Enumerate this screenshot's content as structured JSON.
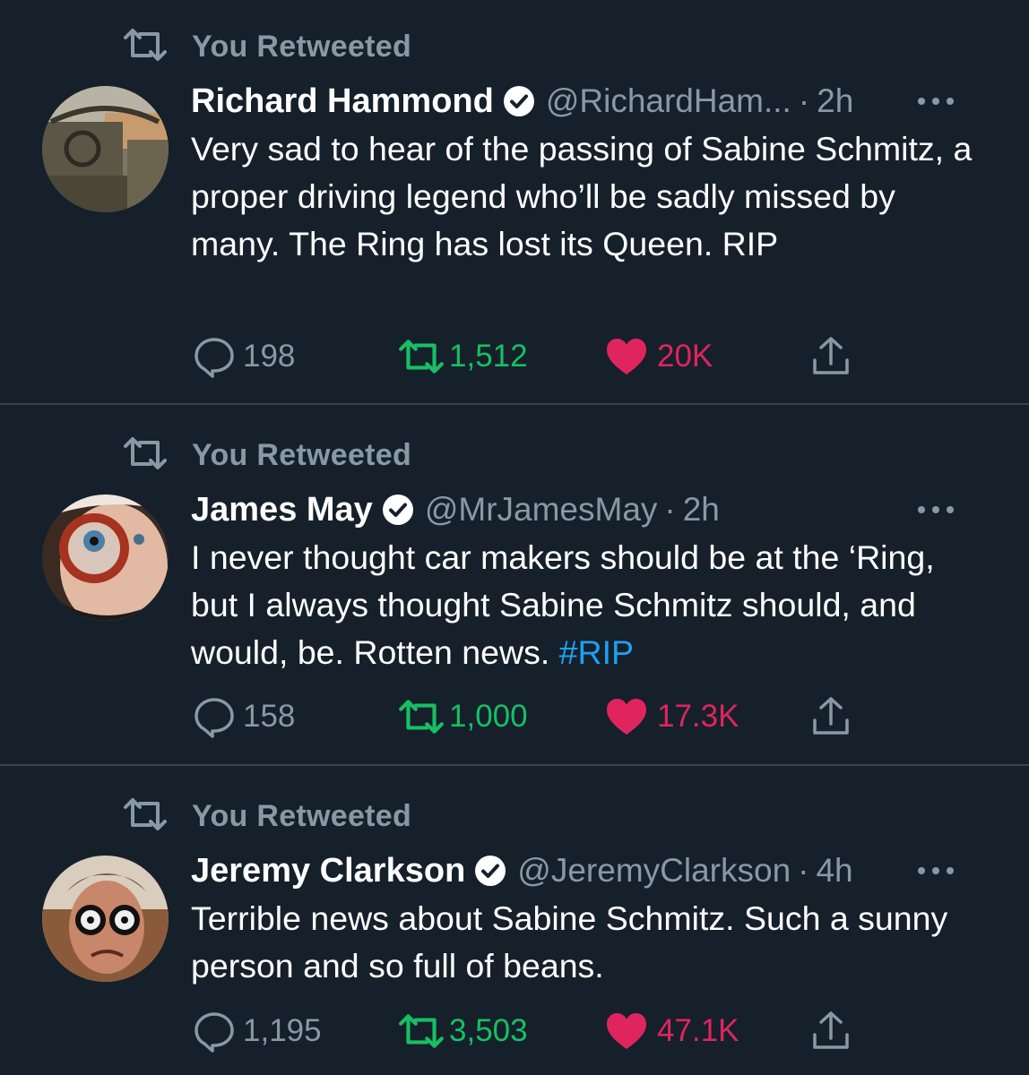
{
  "colors": {
    "background": "#15202b",
    "divider": "#38444d",
    "secondary_text": "#8899a6",
    "retweet_green": "#17bf63",
    "like_red": "#e0245e",
    "hashtag_blue": "#1da1f2",
    "verified_blue": "#1da1f2"
  },
  "tweets": [
    {
      "retweet_label": "You Retweeted",
      "name": "Richard Hammond",
      "handle": "@RichardHam...",
      "separator": "·",
      "time": "2h",
      "text": "Very sad to hear of the passing of Sabine Schmitz, a proper driving legend who’ll be sadly missed by many. The Ring has lost its Queen. RIP",
      "hashtag": "",
      "replies": "198",
      "retweets": "1,512",
      "likes": "20K",
      "icons": [
        "retweet-icon",
        "verified-badge-icon",
        "more-icon",
        "reply-icon",
        "retweet-icon",
        "heart-icon",
        "share-icon"
      ]
    },
    {
      "retweet_label": "You Retweeted",
      "name": "James May",
      "handle": "@MrJamesMay",
      "separator": "·",
      "time": "2h",
      "text": "I never thought car makers should be at the ‘Ring, but I always thought Sabine Schmitz should, and would, be. Rotten news. ",
      "hashtag": "#RIP",
      "replies": "158",
      "retweets": "1,000",
      "likes": "17.3K",
      "icons": [
        "retweet-icon",
        "verified-badge-icon",
        "more-icon",
        "reply-icon",
        "retweet-icon",
        "heart-icon",
        "share-icon"
      ]
    },
    {
      "retweet_label": "You Retweeted",
      "name": "Jeremy Clarkson",
      "handle": "@JeremyClarkson",
      "separator": "·",
      "time": "4h",
      "text": "Terrible news about Sabine Schmitz. Such a sunny person and so full of beans.",
      "hashtag": "",
      "replies": "1,195",
      "retweets": "3,503",
      "likes": "47.1K",
      "icons": [
        "retweet-icon",
        "verified-badge-icon",
        "more-icon",
        "reply-icon",
        "retweet-icon",
        "heart-icon",
        "share-icon"
      ]
    }
  ]
}
